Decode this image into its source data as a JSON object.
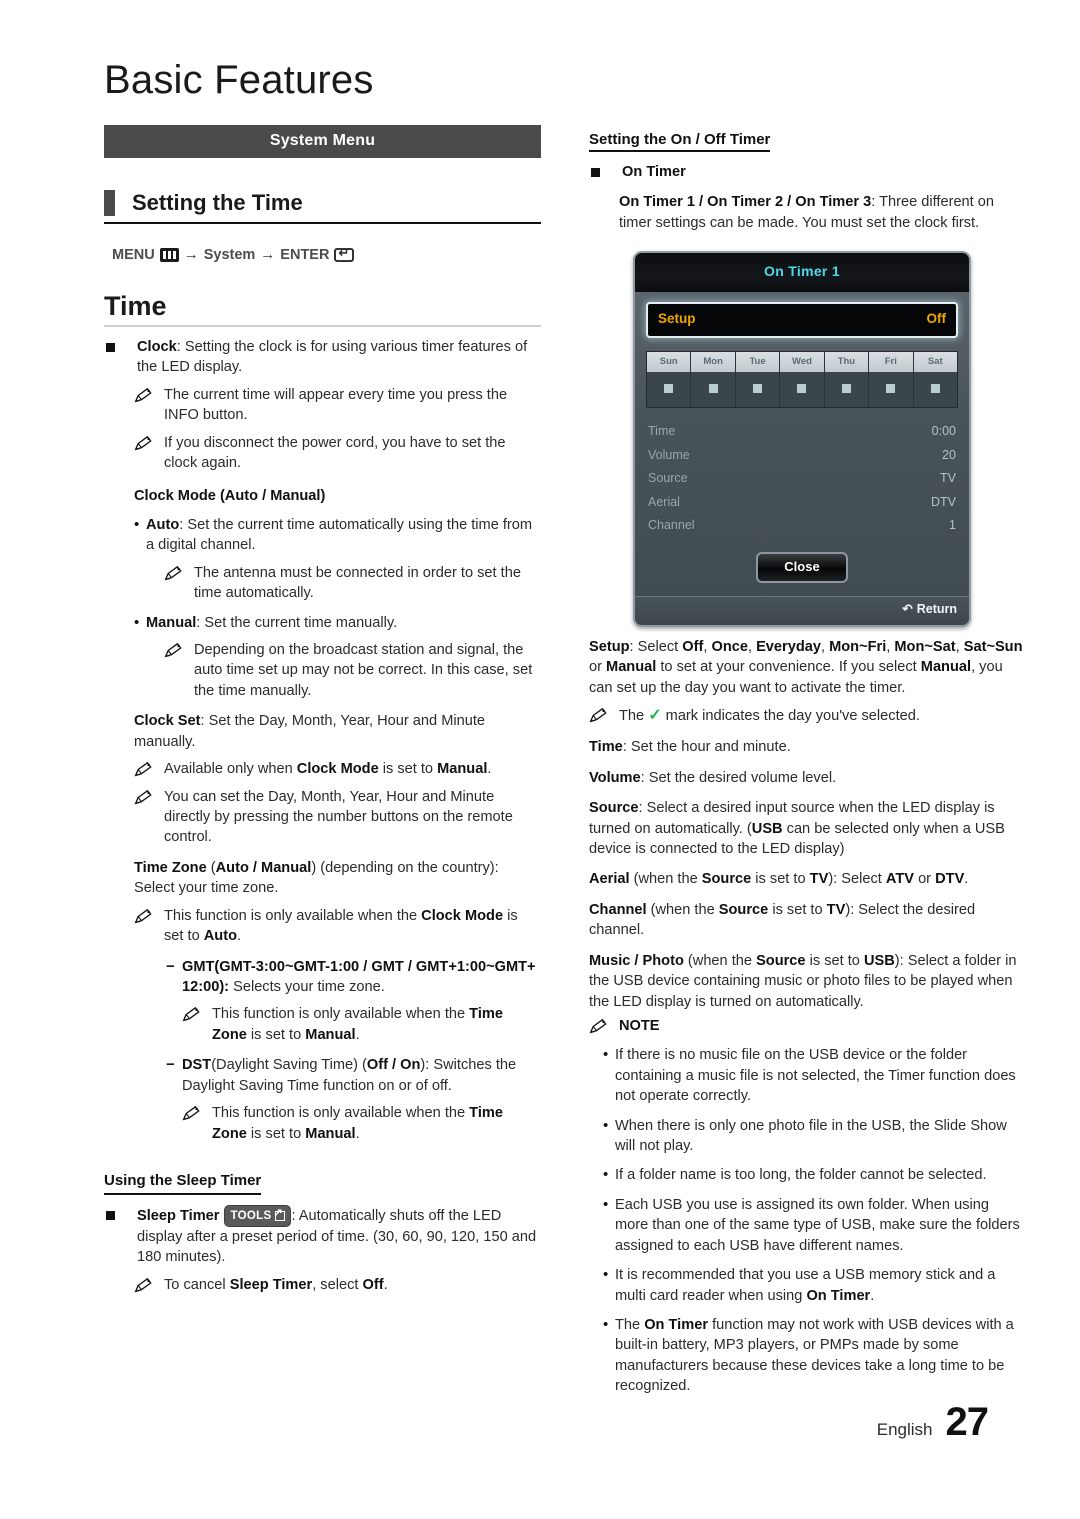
{
  "page": {
    "title": "Basic Features",
    "footer_language": "English",
    "footer_page_number": "27"
  },
  "left": {
    "banner": "System Menu",
    "section_heading": "Setting the Time",
    "menu_path": {
      "menu_label": "MENU",
      "menu_icon": "menu-icon",
      "arrow1": "→",
      "system_label": "System",
      "arrow2": "→",
      "enter_label": "ENTER",
      "enter_icon": "enter-icon"
    },
    "time_heading": "Time",
    "clock_item": {
      "term": "Clock",
      "text": ": Setting the clock is for using various timer features of the LED display."
    },
    "clock_notes": [
      "The current time will appear every time you press the INFO button.",
      "If you disconnect the power cord, you have to set the clock again."
    ],
    "clock_mode_heading": "Clock Mode (Auto / Manual)",
    "clock_mode_auto": {
      "term": "Auto",
      "text": ": Set the current time automatically using the time from a digital channel."
    },
    "clock_mode_auto_note": "The antenna must be connected in order to set the time automatically.",
    "clock_mode_manual": {
      "term": "Manual",
      "text": ": Set the current time manually."
    },
    "clock_mode_manual_note": "Depending on the broadcast station and signal, the auto time set up may not be correct. In this case, set the time manually.",
    "clock_set": {
      "term": "Clock Set",
      "text": ": Set the Day, Month, Year, Hour and Minute manually."
    },
    "clock_set_note1": {
      "pre": "Available only when ",
      "b1": "Clock Mode",
      "mid": " is set to ",
      "b2": "Manual",
      "post": "."
    },
    "clock_set_note2": "You can set the Day, Month, Year, Hour and Minute directly by pressing the number buttons on the remote control.",
    "time_zone": {
      "term": "Time Zone",
      "paren_open": " (",
      "b1": "Auto / Manual",
      "paren_close": ") (depending on the country): Select your time zone."
    },
    "time_zone_note": {
      "pre": "This function is only available when the ",
      "b1": "Clock Mode",
      "mid": " is set to ",
      "b2": "Auto",
      "post": "."
    },
    "gmt_item": {
      "b1": "GMT(GMT-3:00~GMT-1:00 / GMT / GMT+1:00~GMT+ 12:00):",
      "text": " Selects your time zone."
    },
    "gmt_note": {
      "pre": "This function is only available when the ",
      "b1": "Time Zone",
      "mid": " is set to ",
      "b2": "Manual",
      "post": "."
    },
    "dst_item": {
      "b1": "DST",
      "t1": "(Daylight Saving Time) (",
      "b2": "Off / On",
      "t2": "): Switches the Daylight Saving Time function on or of off."
    },
    "dst_note": {
      "pre": "This function is only available when the ",
      "b1": "Time Zone",
      "mid": " is set to ",
      "b2": "Manual",
      "post": "."
    },
    "sleep_timer_heading": "Using the Sleep Timer",
    "sleep_timer": {
      "term": "Sleep Timer",
      "badge": "TOOLS",
      "text": ": Automatically shuts off the LED display after a preset period of time. (30, 60, 90, 120, 150 and 180 minutes)."
    },
    "sleep_timer_note": {
      "pre": "To cancel ",
      "b1": "Sleep Timer",
      "mid": ", select ",
      "b2": "Off",
      "post": "."
    }
  },
  "right": {
    "section_heading": "Setting the On / Off Timer",
    "on_timer_item": "On Timer",
    "on_timer_desc": {
      "b1": "On Timer 1 / On Timer 2 / On Timer 3",
      "text": ": Three different on timer settings can be made. You must set the clock first."
    },
    "osd": {
      "title": "On Timer 1",
      "setup_label": "Setup",
      "setup_value": "Off",
      "days": [
        "Sun",
        "Mon",
        "Tue",
        "Wed",
        "Thu",
        "Fri",
        "Sat"
      ],
      "rows": [
        {
          "label": "Time",
          "value": "0:00"
        },
        {
          "label": "Volume",
          "value": "20"
        },
        {
          "label": "Source",
          "value": "TV"
        },
        {
          "label": "Aerial",
          "value": "DTV"
        },
        {
          "label": "Channel",
          "value": "1"
        }
      ],
      "close_button": "Close",
      "return_label": "Return",
      "return_icon": "return-arrow-icon",
      "colors": {
        "title_text": "#4fd8e8",
        "setup_text": "#f0a500",
        "panel_bg": "#49535a",
        "checkbox": "#b9cdd3"
      }
    },
    "setup_desc": {
      "b_term": "Setup",
      "t1": ": Select ",
      "b1": "Off",
      "t2": ", ",
      "b2": "Once",
      "t3": ", ",
      "b3": "Everyday",
      "t4": ", ",
      "b4": "Mon~Fri",
      "t5": ", ",
      "b5": "Mon~Sat",
      "t6": ", ",
      "b6": "Sat~Sun",
      "t7": " or ",
      "b7": "Manual",
      "t8": " to set at your convenience. If you select ",
      "b8": "Manual",
      "t9": ", you can set up the day you want to activate the timer."
    },
    "check_note": {
      "pre": "The ",
      "check": "✓",
      "post": " mark indicates the day you've selected."
    },
    "time_desc": {
      "term": "Time",
      "text": ": Set the hour and minute."
    },
    "volume_desc": {
      "term": "Volume",
      "text": ": Set the desired volume level."
    },
    "source_desc": {
      "term": "Source",
      "t1": ": Select a desired input source when the LED display is turned on automatically. (",
      "b1": "USB",
      "t2": " can be selected only when a USB device is connected to the LED display)"
    },
    "aerial_desc": {
      "term": "Aerial",
      "t1": " (when the ",
      "b1": "Source",
      "t2": " is set to ",
      "b2": "TV",
      "t3": "): Select ",
      "b3": "ATV",
      "t4": " or ",
      "b4": "DTV",
      "t5": "."
    },
    "channel_desc": {
      "term": "Channel",
      "t1": " (when the ",
      "b1": "Source",
      "t2": " is set to ",
      "b2": "TV",
      "t3": "): Select the desired channel."
    },
    "music_desc": {
      "term": "Music / Photo",
      "t1": " (when the ",
      "b1": "Source",
      "t2": " is set to ",
      "b2": "USB",
      "t3": "): Select a folder in the USB device containing music or photo files to be played when the LED display is turned on automatically."
    },
    "note_heading": "NOTE",
    "notes": [
      "If there is no music file on the USB device or the folder containing a music file is not selected, the Timer function does not operate correctly.",
      "When there is only one photo file in the USB, the Slide Show will not play.",
      "If a folder name is too long, the folder cannot be selected.",
      "Each USB you use is assigned its own folder. When using more than one of the same type of USB, make sure the folders assigned to each USB have different names."
    ],
    "note_recommend": {
      "t1": "It is recommended that you use a USB memory stick and a multi card reader when using ",
      "b1": "On Timer",
      "t2": "."
    },
    "note_ontimer": {
      "t1": "The ",
      "b1": "On Timer",
      "t2": " function may not work with USB devices with a built-in battery, MP3 players, or PMPs made by some manufacturers because these devices take a long time to be recognized."
    }
  }
}
